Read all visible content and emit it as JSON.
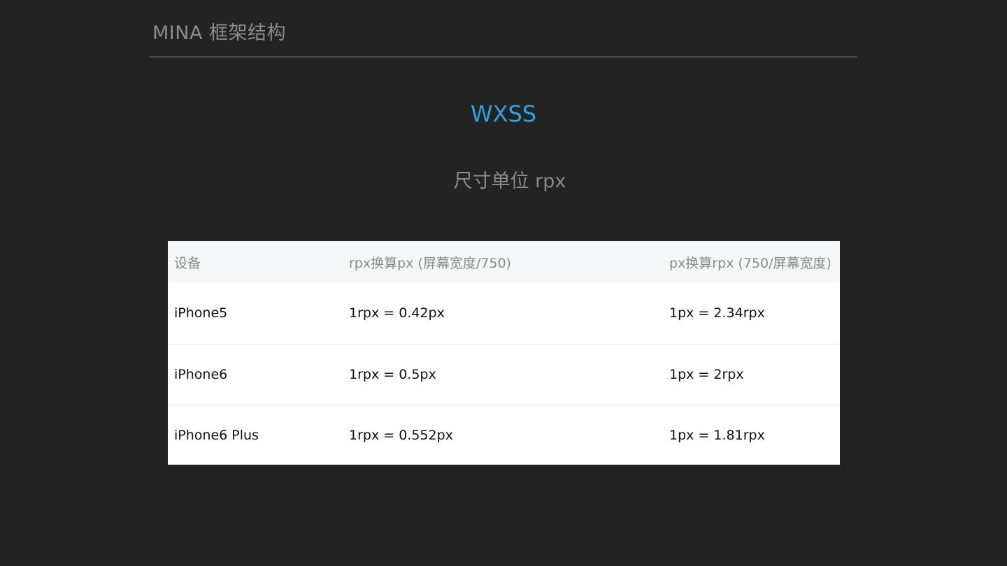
{
  "header": {
    "title": "MINA  框架结构"
  },
  "slide": {
    "title": "WXSS",
    "subtitle": "尺寸单位  rpx"
  },
  "table": {
    "headers": [
      "设备",
      "rpx换算px (屏幕宽度/750)",
      "px换算rpx (750/屏幕宽度)"
    ],
    "rows": [
      [
        "iPhone5",
        "1rpx = 0.42px",
        "1px = 2.34rpx"
      ],
      [
        "iPhone6",
        "1rpx = 0.5px",
        "1px = 2rpx"
      ],
      [
        "iPhone6 Plus",
        "1rpx = 0.552px",
        "1px = 1.81rpx"
      ]
    ]
  },
  "colors": {
    "background": "#232323",
    "accent": "#2ea1df",
    "muted_text": "#8c8c8c"
  }
}
